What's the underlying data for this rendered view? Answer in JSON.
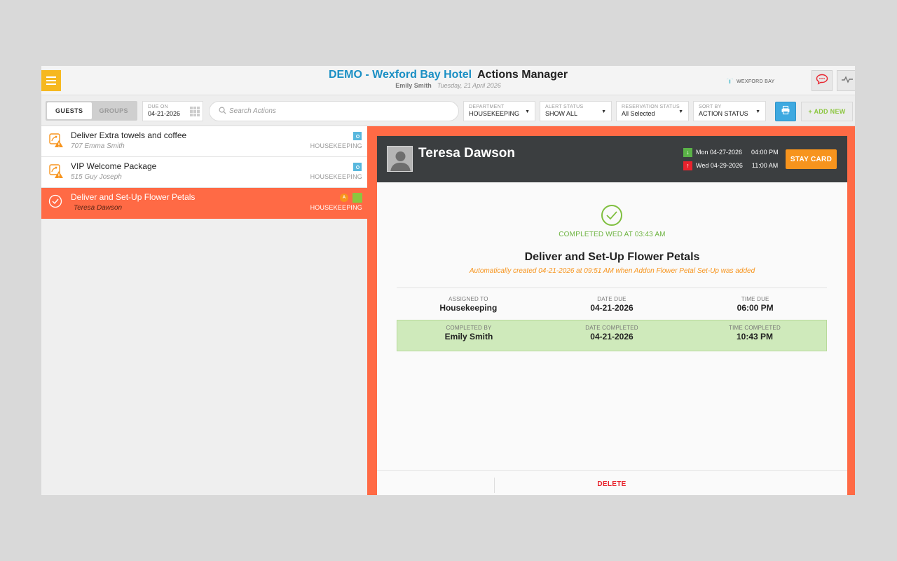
{
  "header": {
    "hotel_title": "DEMO - Wexford Bay Hotel",
    "page_title": "Actions Manager",
    "user": "Emily Smith",
    "date": "Tuesday, 21 April 2026",
    "brand": "WEXFORD BAY"
  },
  "toolbar": {
    "tabs": [
      {
        "label": "GUESTS",
        "active": true
      },
      {
        "label": "GROUPS",
        "active": false
      }
    ],
    "due_on": {
      "label": "DUE ON",
      "value": "04-21-2026"
    },
    "search": {
      "placeholder": "Search Actions"
    },
    "department": {
      "label": "DEPARTMENT",
      "value": "HOUSEKEEPING"
    },
    "alert_status": {
      "label": "ALERT STATUS",
      "value": "SHOW ALL"
    },
    "reservation_status": {
      "label": "RESERVATION STATUS",
      "value": "All Selected"
    },
    "sort_by": {
      "label": "SORT BY",
      "value": "ACTION STATUS"
    },
    "add_new": "+ ADD NEW"
  },
  "actions": [
    {
      "title": "Deliver Extra towels and coffee",
      "subtitle": "707 Emma Smith",
      "department": "HOUSEKEEPING",
      "status": "pending"
    },
    {
      "title": "VIP Welcome Package",
      "subtitle": "515 Guy Joseph",
      "department": "HOUSEKEEPING",
      "status": "pending"
    },
    {
      "title": "Deliver and Set-Up Flower Petals",
      "subtitle": "Teresa Dawson",
      "department": "HOUSEKEEPING",
      "status": "completed",
      "badge": "A"
    }
  ],
  "detail": {
    "guest_name": "Teresa Dawson",
    "arrival": {
      "day": "Mon 04-27-2026",
      "time": "04:00 PM"
    },
    "departure": {
      "day": "Wed 04-29-2026",
      "time": "11:00 AM"
    },
    "stay_card": "STAY CARD",
    "completed_label": "COMPLETED WED AT 03:43 AM",
    "action_title": "Deliver and Set-Up Flower Petals",
    "auto_note": "Automatically created 04-21-2026 at 09:51 AM when Addon Flower Petal Set-Up was added",
    "assigned_to": {
      "label": "ASSIGNED TO",
      "value": "Housekeeping"
    },
    "date_due": {
      "label": "DATE DUE",
      "value": "04-21-2026"
    },
    "time_due": {
      "label": "TIME DUE",
      "value": "06:00 PM"
    },
    "completed_by": {
      "label": "COMPLETED BY",
      "value": "Emily Smith"
    },
    "date_completed": {
      "label": "DATE COMPLETED",
      "value": "04-21-2026"
    },
    "time_completed": {
      "label": "TIME COMPLETED",
      "value": "10:43 PM"
    },
    "delete": "DELETE"
  },
  "colors": {
    "accent_orange": "#ff6a45",
    "brand_blue": "#1a8fc4",
    "success_green": "#7fbf3f",
    "warning_orange": "#f7941d",
    "danger_red": "#e8232d"
  }
}
